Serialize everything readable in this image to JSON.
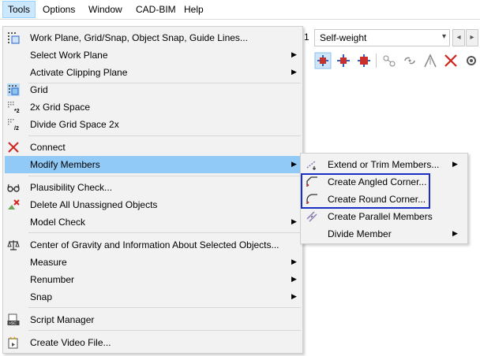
{
  "menubar": {
    "items": [
      {
        "label": "Tools",
        "active": true
      },
      {
        "label": "Options"
      },
      {
        "label": "Window"
      },
      {
        "label": "CAD-BIM"
      },
      {
        "label": "Help"
      }
    ]
  },
  "toolbar": {
    "load_case_number": "1",
    "load_case_name": "Self-weight"
  },
  "tools_menu": {
    "items": [
      {
        "label": "Work Plane, Grid/Snap, Object Snap, Guide Lines...",
        "icon": "work-plane-icon"
      },
      {
        "label": "Select Work Plane",
        "submenu": true
      },
      {
        "label": "Activate Clipping Plane",
        "submenu": true
      },
      {
        "label": "Grid",
        "icon": "grid-icon"
      },
      {
        "label": "2x Grid Space",
        "icon": "grid-double-icon"
      },
      {
        "label": "Divide Grid Space 2x",
        "icon": "grid-divide-icon"
      },
      {
        "label": "Connect",
        "icon": "connect-icon"
      },
      {
        "label": "Modify Members",
        "submenu": true,
        "highlighted": true
      },
      {
        "label": "Plausibility Check...",
        "icon": "glasses-icon"
      },
      {
        "label": "Delete All Unassigned Objects",
        "icon": "delete-unassigned-icon"
      },
      {
        "label": "Model Check",
        "submenu": true
      },
      {
        "label": "Center of Gravity and Information About Selected Objects...",
        "icon": "scale-icon"
      },
      {
        "label": "Measure",
        "submenu": true
      },
      {
        "label": "Renumber",
        "submenu": true
      },
      {
        "label": "Snap",
        "submenu": true
      },
      {
        "label": "Script Manager",
        "icon": "script-icon"
      },
      {
        "label": "Create Video File...",
        "icon": "video-icon"
      }
    ]
  },
  "modify_members_submenu": {
    "items": [
      {
        "label": "Extend or Trim Members...",
        "icon": "extend-trim-icon",
        "submenu": true
      },
      {
        "label": "Create Angled Corner...",
        "icon": "angled-corner-icon"
      },
      {
        "label": "Create Round Corner...",
        "icon": "round-corner-icon"
      },
      {
        "label": "Create Parallel Members",
        "icon": "parallel-members-icon"
      },
      {
        "label": "Divide Member",
        "submenu": true
      }
    ]
  },
  "colors": {
    "highlight": "#91c9f7",
    "menu_bg": "#f2f2f2",
    "callout_border": "#1c2fc4"
  }
}
